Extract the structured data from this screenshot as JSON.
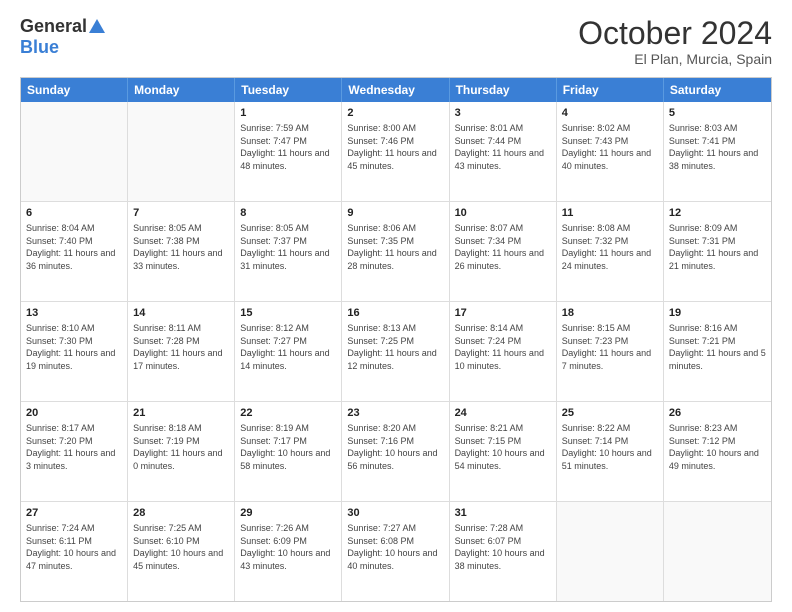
{
  "logo": {
    "general": "General",
    "blue": "Blue"
  },
  "title": "October 2024",
  "location": "El Plan, Murcia, Spain",
  "days": [
    "Sunday",
    "Monday",
    "Tuesday",
    "Wednesday",
    "Thursday",
    "Friday",
    "Saturday"
  ],
  "weeks": [
    [
      {
        "day": "",
        "content": ""
      },
      {
        "day": "",
        "content": ""
      },
      {
        "day": "1",
        "content": "Sunrise: 7:59 AM\nSunset: 7:47 PM\nDaylight: 11 hours and 48 minutes."
      },
      {
        "day": "2",
        "content": "Sunrise: 8:00 AM\nSunset: 7:46 PM\nDaylight: 11 hours and 45 minutes."
      },
      {
        "day": "3",
        "content": "Sunrise: 8:01 AM\nSunset: 7:44 PM\nDaylight: 11 hours and 43 minutes."
      },
      {
        "day": "4",
        "content": "Sunrise: 8:02 AM\nSunset: 7:43 PM\nDaylight: 11 hours and 40 minutes."
      },
      {
        "day": "5",
        "content": "Sunrise: 8:03 AM\nSunset: 7:41 PM\nDaylight: 11 hours and 38 minutes."
      }
    ],
    [
      {
        "day": "6",
        "content": "Sunrise: 8:04 AM\nSunset: 7:40 PM\nDaylight: 11 hours and 36 minutes."
      },
      {
        "day": "7",
        "content": "Sunrise: 8:05 AM\nSunset: 7:38 PM\nDaylight: 11 hours and 33 minutes."
      },
      {
        "day": "8",
        "content": "Sunrise: 8:05 AM\nSunset: 7:37 PM\nDaylight: 11 hours and 31 minutes."
      },
      {
        "day": "9",
        "content": "Sunrise: 8:06 AM\nSunset: 7:35 PM\nDaylight: 11 hours and 28 minutes."
      },
      {
        "day": "10",
        "content": "Sunrise: 8:07 AM\nSunset: 7:34 PM\nDaylight: 11 hours and 26 minutes."
      },
      {
        "day": "11",
        "content": "Sunrise: 8:08 AM\nSunset: 7:32 PM\nDaylight: 11 hours and 24 minutes."
      },
      {
        "day": "12",
        "content": "Sunrise: 8:09 AM\nSunset: 7:31 PM\nDaylight: 11 hours and 21 minutes."
      }
    ],
    [
      {
        "day": "13",
        "content": "Sunrise: 8:10 AM\nSunset: 7:30 PM\nDaylight: 11 hours and 19 minutes."
      },
      {
        "day": "14",
        "content": "Sunrise: 8:11 AM\nSunset: 7:28 PM\nDaylight: 11 hours and 17 minutes."
      },
      {
        "day": "15",
        "content": "Sunrise: 8:12 AM\nSunset: 7:27 PM\nDaylight: 11 hours and 14 minutes."
      },
      {
        "day": "16",
        "content": "Sunrise: 8:13 AM\nSunset: 7:25 PM\nDaylight: 11 hours and 12 minutes."
      },
      {
        "day": "17",
        "content": "Sunrise: 8:14 AM\nSunset: 7:24 PM\nDaylight: 11 hours and 10 minutes."
      },
      {
        "day": "18",
        "content": "Sunrise: 8:15 AM\nSunset: 7:23 PM\nDaylight: 11 hours and 7 minutes."
      },
      {
        "day": "19",
        "content": "Sunrise: 8:16 AM\nSunset: 7:21 PM\nDaylight: 11 hours and 5 minutes."
      }
    ],
    [
      {
        "day": "20",
        "content": "Sunrise: 8:17 AM\nSunset: 7:20 PM\nDaylight: 11 hours and 3 minutes."
      },
      {
        "day": "21",
        "content": "Sunrise: 8:18 AM\nSunset: 7:19 PM\nDaylight: 11 hours and 0 minutes."
      },
      {
        "day": "22",
        "content": "Sunrise: 8:19 AM\nSunset: 7:17 PM\nDaylight: 10 hours and 58 minutes."
      },
      {
        "day": "23",
        "content": "Sunrise: 8:20 AM\nSunset: 7:16 PM\nDaylight: 10 hours and 56 minutes."
      },
      {
        "day": "24",
        "content": "Sunrise: 8:21 AM\nSunset: 7:15 PM\nDaylight: 10 hours and 54 minutes."
      },
      {
        "day": "25",
        "content": "Sunrise: 8:22 AM\nSunset: 7:14 PM\nDaylight: 10 hours and 51 minutes."
      },
      {
        "day": "26",
        "content": "Sunrise: 8:23 AM\nSunset: 7:12 PM\nDaylight: 10 hours and 49 minutes."
      }
    ],
    [
      {
        "day": "27",
        "content": "Sunrise: 7:24 AM\nSunset: 6:11 PM\nDaylight: 10 hours and 47 minutes."
      },
      {
        "day": "28",
        "content": "Sunrise: 7:25 AM\nSunset: 6:10 PM\nDaylight: 10 hours and 45 minutes."
      },
      {
        "day": "29",
        "content": "Sunrise: 7:26 AM\nSunset: 6:09 PM\nDaylight: 10 hours and 43 minutes."
      },
      {
        "day": "30",
        "content": "Sunrise: 7:27 AM\nSunset: 6:08 PM\nDaylight: 10 hours and 40 minutes."
      },
      {
        "day": "31",
        "content": "Sunrise: 7:28 AM\nSunset: 6:07 PM\nDaylight: 10 hours and 38 minutes."
      },
      {
        "day": "",
        "content": ""
      },
      {
        "day": "",
        "content": ""
      }
    ]
  ]
}
